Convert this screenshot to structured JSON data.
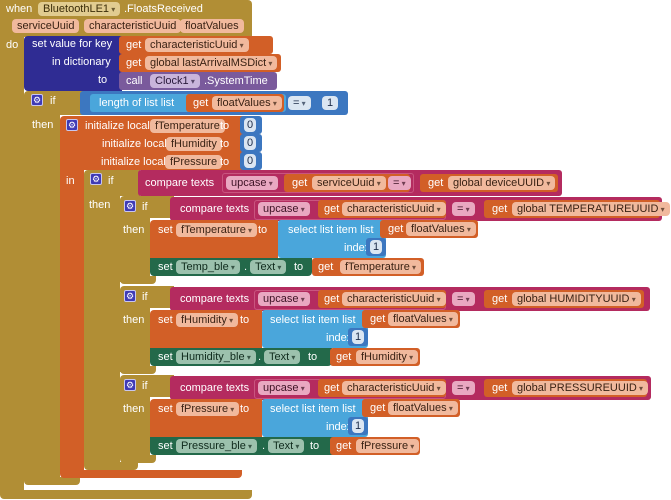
{
  "event": {
    "when_label": "when",
    "component": "BluetoothLE1",
    "event_name": ".FloatsReceived",
    "params": [
      "serviceUuid",
      "characteristicUuid",
      "floatValues"
    ],
    "do_label": "do"
  },
  "dict_set": {
    "set_label": "set value for key",
    "in_label": "in dictionary",
    "to_label": "to",
    "key_get": "get",
    "key_var": "characteristicUuid",
    "dict_get": "get",
    "dict_var": "global lastArrivalMSDict",
    "call_label": "call",
    "clock": "Clock1",
    "method": ".SystemTime"
  },
  "outer_if": {
    "if_label": "if",
    "then_label": "then",
    "length_label": "length of list  list",
    "get_label": "get",
    "var": "floatValues",
    "op": "=",
    "value": "1"
  },
  "locals": {
    "init_label": "initialize local",
    "to_label": "to",
    "in_label": "in",
    "vars": [
      {
        "name": "fTemperature",
        "value": "0"
      },
      {
        "name": "fHumidity",
        "value": "0"
      },
      {
        "name": "fPressure",
        "value": "0"
      }
    ]
  },
  "service_if": {
    "if_label": "if",
    "then_label": "then",
    "compare_label": "compare texts",
    "upcase": "upcase",
    "get_label": "get",
    "var": "serviceUuid",
    "op": "=",
    "global_var": "global deviceUUID"
  },
  "char_ifs": [
    {
      "if_label": "if",
      "then_label": "then",
      "compare_label": "compare texts",
      "upcase": "upcase",
      "get_label": "get",
      "var": "characteristicUuid",
      "op": "=",
      "global_var": "global TEMPERATUREUUID",
      "set_label": "set",
      "local": "fTemperature",
      "to_label": "to",
      "select_label": "select list item  list",
      "list_var": "floatValues",
      "index_label": "index",
      "index": "1",
      "label_comp": "Temp_ble",
      "prop": "Text",
      "dot": "."
    },
    {
      "if_label": "if",
      "then_label": "then",
      "compare_label": "compare texts",
      "upcase": "upcase",
      "get_label": "get",
      "var": "characteristicUuid",
      "op": "=",
      "global_var": "global HUMIDITYUUID",
      "set_label": "set",
      "local": "fHumidity",
      "to_label": "to",
      "select_label": "select list item  list",
      "list_var": "floatValues",
      "index_label": "index",
      "index": "1",
      "label_comp": "Humidity_ble",
      "prop": "Text",
      "dot": "."
    },
    {
      "if_label": "if",
      "then_label": "then",
      "compare_label": "compare texts",
      "upcase": "upcase",
      "get_label": "get",
      "var": "characteristicUuid",
      "op": "=",
      "global_var": "global PRESSUREUUID",
      "set_label": "set",
      "local": "fPressure",
      "to_label": "to",
      "select_label": "select list item  list",
      "list_var": "floatValues",
      "index_label": "index",
      "index": "1",
      "label_comp": "Pressure_ble",
      "prop": "Text",
      "dot": "."
    }
  ]
}
